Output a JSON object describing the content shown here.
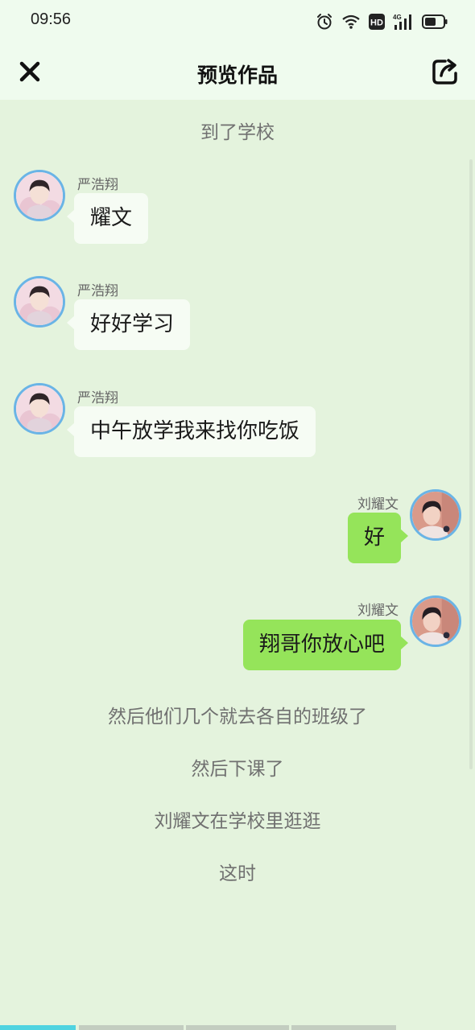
{
  "status_bar": {
    "time": "09:56",
    "icons": [
      "alarm-icon",
      "wifi-icon",
      "hd-icon",
      "signal-4g-icon",
      "battery-icon"
    ],
    "network": "4G"
  },
  "header": {
    "title": "预览作品",
    "close_icon": "close-icon",
    "share_icon": "share-icon"
  },
  "colors": {
    "background": "#e4f3dd",
    "header_background": "#effbee",
    "left_bubble": "#f6fcf4",
    "right_bubble": "#95e45a",
    "avatar_border": "#6ab4e6",
    "progress_active": "#4fd3e0"
  },
  "story": {
    "opening": "到了学校",
    "messages": [
      {
        "side": "left",
        "sender": "严浩翔",
        "text": "耀文"
      },
      {
        "side": "left",
        "sender": "严浩翔",
        "text": "好好学习"
      },
      {
        "side": "left",
        "sender": "严浩翔",
        "text": "中午放学我来找你吃饭"
      },
      {
        "side": "right",
        "sender": "刘耀文",
        "text": "好"
      },
      {
        "side": "right",
        "sender": "刘耀文",
        "text": "翔哥你放心吧"
      }
    ],
    "narrations": [
      "然后他们几个就去各自的班级了",
      "然后下课了",
      "刘耀文在学校里逛逛",
      "这时"
    ]
  },
  "progress": {
    "segments": 4,
    "active_segment": 1
  }
}
